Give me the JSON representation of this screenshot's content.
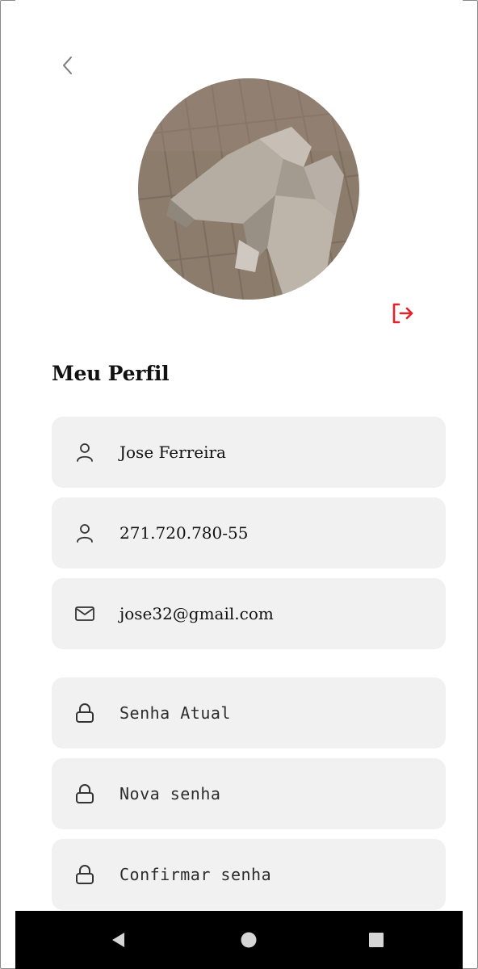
{
  "header": {
    "back_icon": "chevron-left-icon",
    "logout_icon": "logout-icon",
    "logout_color": "#e0242b"
  },
  "profile": {
    "title": "Meu Perfil",
    "name": "Jose Ferreira",
    "document": "271.720.780-55",
    "email": "jose32@gmail.com"
  },
  "password": {
    "current_placeholder": "Senha Atual",
    "new_placeholder": "Nova senha",
    "confirm_placeholder": "Confirmar senha"
  },
  "icons": {
    "name": "user-icon",
    "document": "user-icon",
    "email": "mail-icon",
    "password": "lock-icon"
  },
  "system_nav": {
    "back": "nav-back-icon",
    "home": "nav-home-icon",
    "recents": "nav-recents-icon"
  },
  "colors": {
    "field_bg": "#f1f1f1",
    "navbar_bg": "#000000",
    "accent_red": "#e0242b"
  }
}
